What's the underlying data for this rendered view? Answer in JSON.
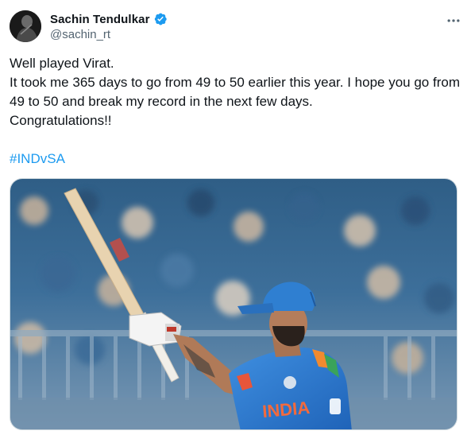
{
  "author": {
    "display_name": "Sachin Tendulkar",
    "handle": "@sachin_rt",
    "verified": true,
    "avatar_icon": "profile-avatar"
  },
  "tweet": {
    "lines": [
      "Well played Virat.",
      "It took me 365 days to go from 49 to 50 earlier this year. I hope you go from 49 to 50 and break my record in the next few days.",
      "Congratulations!!"
    ],
    "hashtag": "#INDvSA"
  },
  "media": {
    "type": "photo",
    "jersey_text": "INDIA"
  },
  "colors": {
    "text": "#0f1419",
    "secondary": "#536471",
    "link": "#1d9bf0",
    "verified": "#1d9bf0",
    "border": "#cfd9de"
  },
  "icons": {
    "verified": "verified-badge-icon",
    "more": "more-options-icon"
  }
}
